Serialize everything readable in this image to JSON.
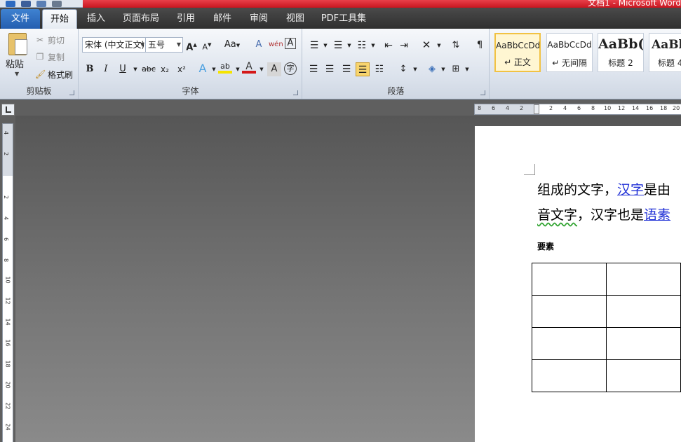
{
  "window": {
    "title": "文档1 - Microsoft Word"
  },
  "tabs": [
    {
      "label": "文件",
      "kind": "file"
    },
    {
      "label": "开始",
      "kind": "active"
    },
    {
      "label": "插入"
    },
    {
      "label": "页面布局"
    },
    {
      "label": "引用"
    },
    {
      "label": "邮件"
    },
    {
      "label": "审阅"
    },
    {
      "label": "视图"
    },
    {
      "label": "PDF工具集"
    }
  ],
  "clipboard": {
    "paste": "粘贴",
    "cut": "剪切",
    "copy": "复制",
    "format_painter": "格式刷",
    "group_label": "剪贴板"
  },
  "font": {
    "font_name": "宋体 (中文正文)",
    "font_size": "五号",
    "grow": "A",
    "shrink": "A",
    "change_case": "Aa",
    "clear_format": "A",
    "phonetic": "wén",
    "char_border": "A",
    "bold": "B",
    "italic": "I",
    "underline": "U",
    "strikethrough": "abc",
    "subscript": "x₂",
    "superscript": "x²",
    "text_effect": "A",
    "highlight": "ab",
    "font_color": "A",
    "char_shading": "A",
    "enclose": "字",
    "group_label": "字体"
  },
  "paragraph": {
    "group_label": "段落"
  },
  "styles": [
    {
      "sample": "AaBbCcDd",
      "name": "↵ 正文",
      "selected": true
    },
    {
      "sample": "AaBbCcDd",
      "name": "↵ 无间隔"
    },
    {
      "sample": "AaBb(",
      "name": "标题 2"
    },
    {
      "sample": "AaBb",
      "name": "标题 4"
    }
  ],
  "ruler": {
    "h_numbers": [
      "8",
      "6",
      "4",
      "2",
      "2",
      "4",
      "6",
      "8",
      "10",
      "12",
      "14",
      "16",
      "18",
      "20"
    ],
    "v_numbers": [
      "4",
      "2",
      "2",
      "4",
      "6",
      "8",
      "10",
      "12",
      "14",
      "16",
      "18",
      "20",
      "22",
      "24"
    ]
  },
  "document": {
    "line1": {
      "text1": "组成的文字，",
      "link1": "汉字",
      "text2": "是由"
    },
    "line2": {
      "wavy": "音文字",
      "text1": "，汉字也是",
      "link1": "语素"
    },
    "caption": "要素"
  },
  "colors": {
    "title_bar": "#d01c26",
    "file_tab": "#2f6fc4",
    "link": "#1f2fd6",
    "workspace": "#6a6a6a"
  }
}
